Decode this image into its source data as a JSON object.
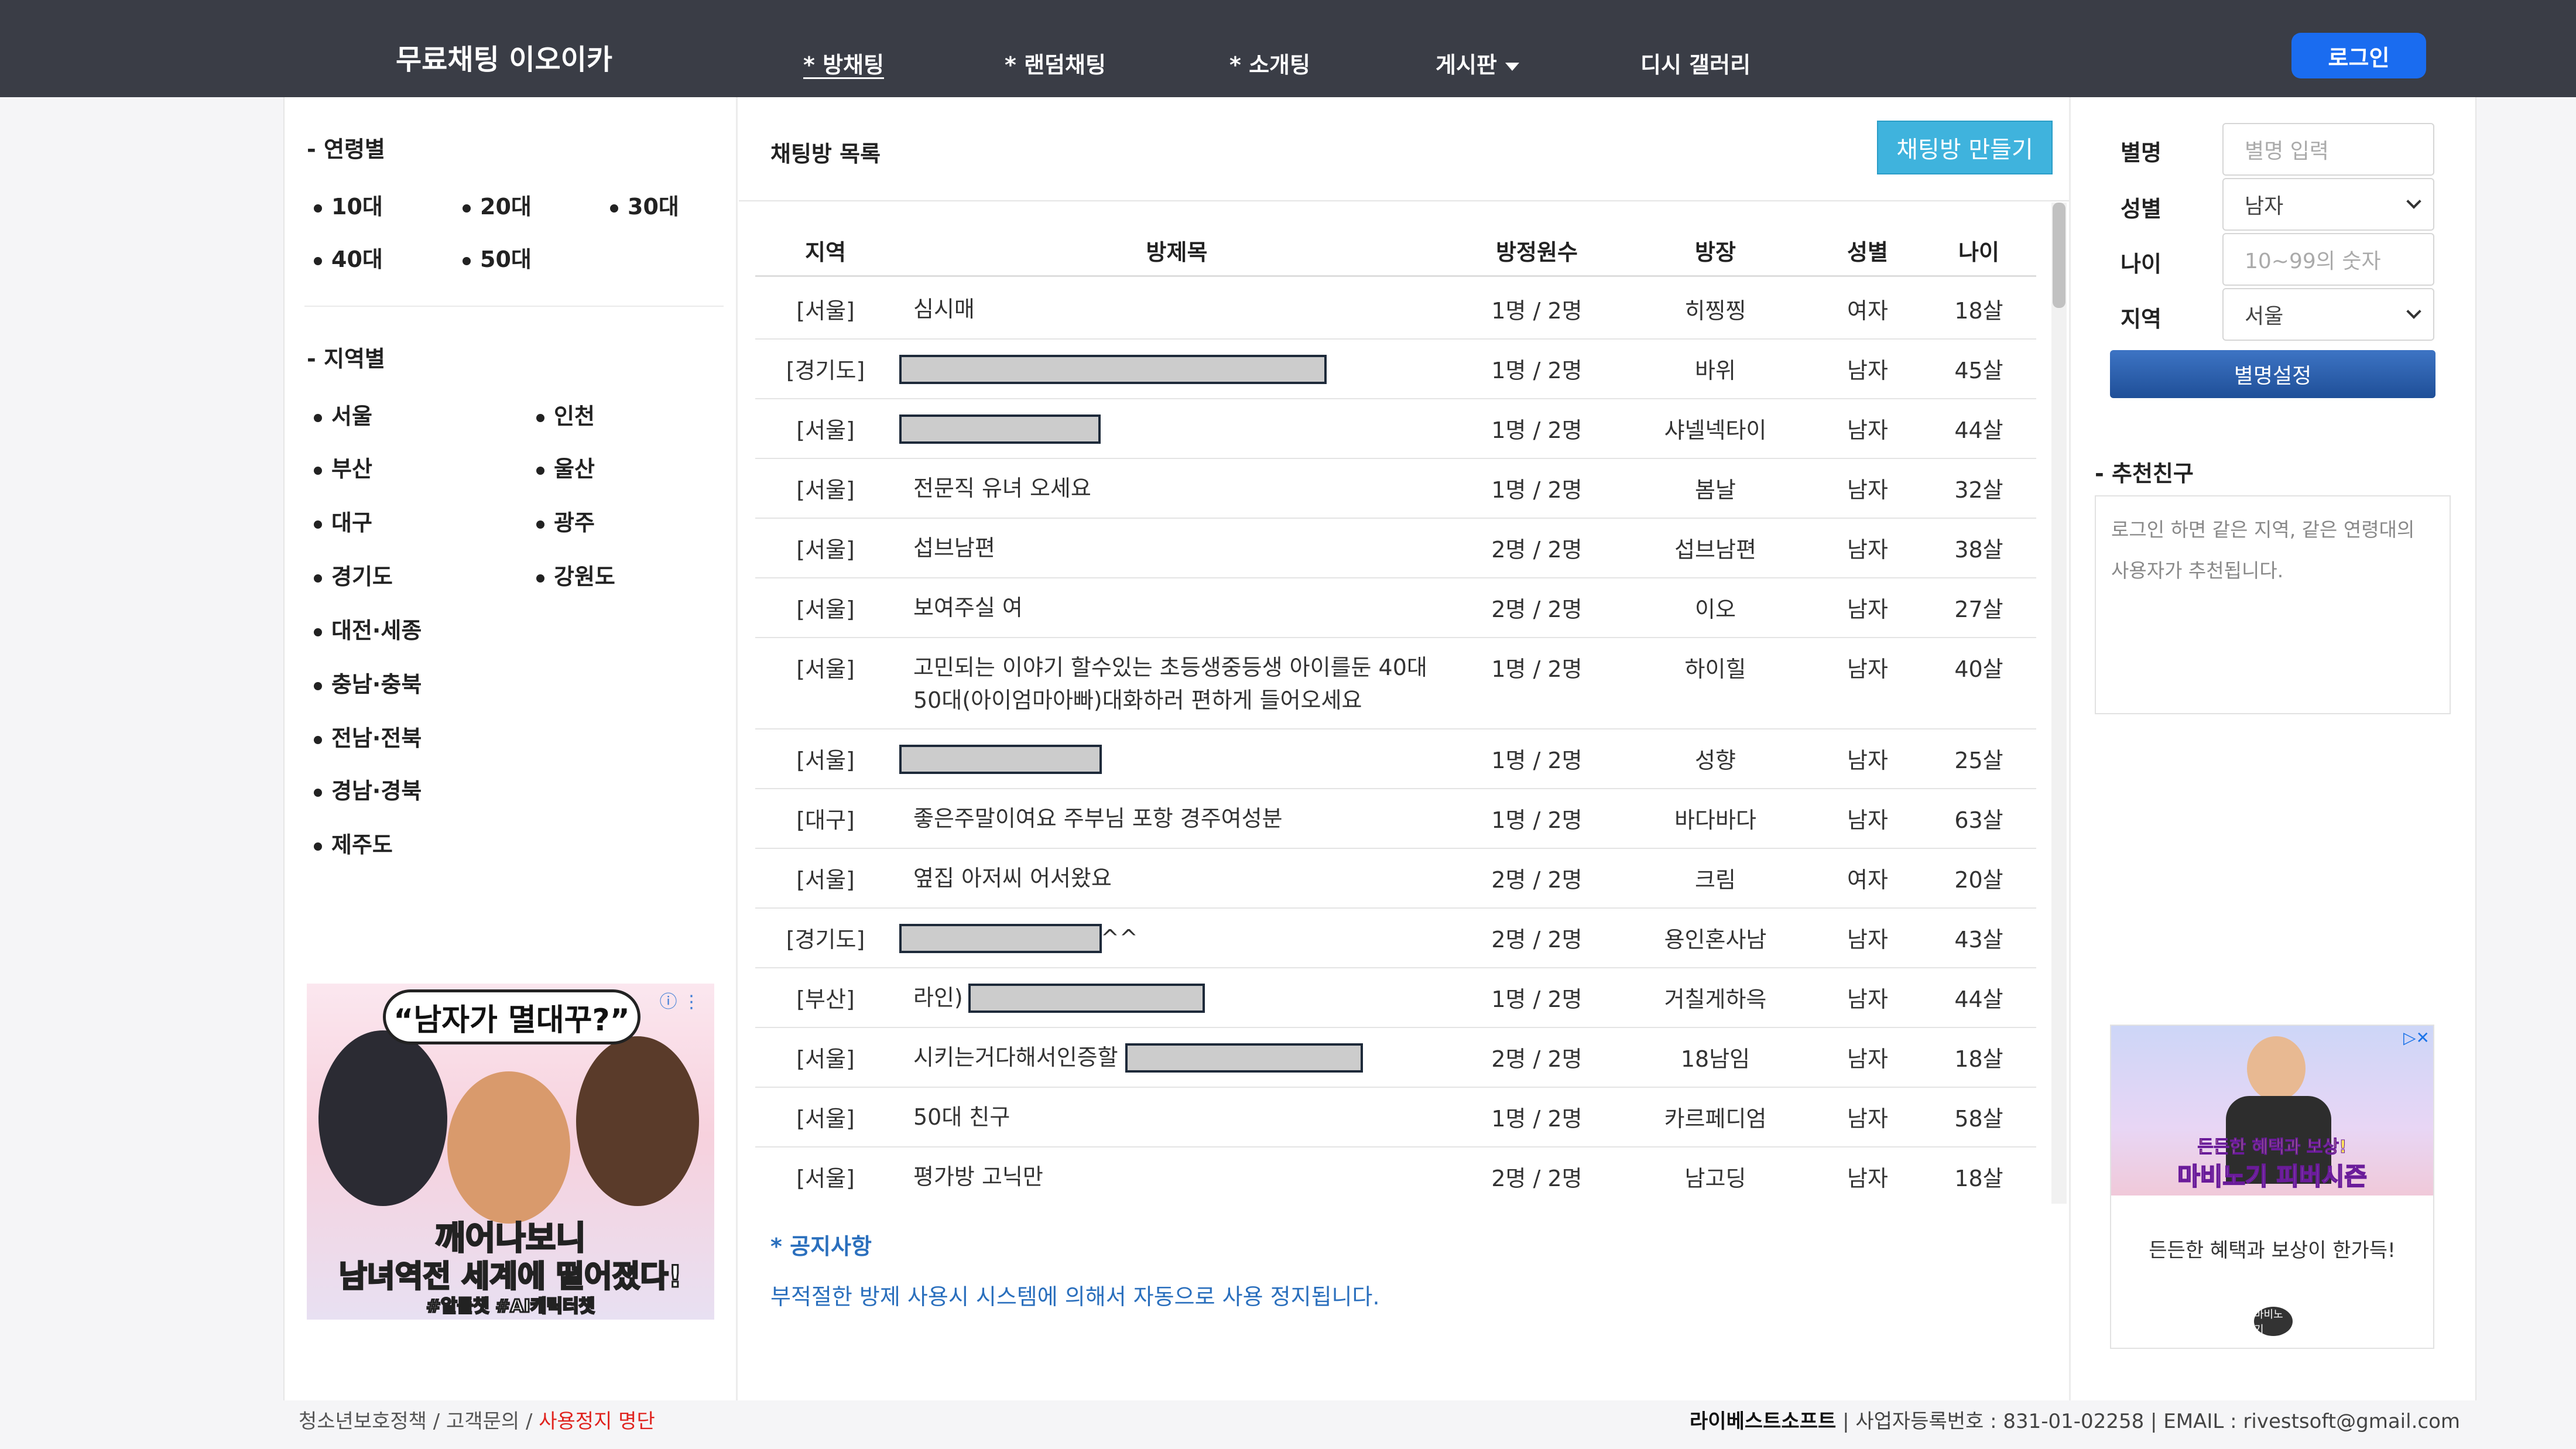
{
  "header": {
    "brand": "무료채팅 이오이카",
    "nav": [
      {
        "label": "* 방채팅",
        "active": true
      },
      {
        "label": "* 랜덤채팅",
        "active": false
      },
      {
        "label": "* 소개팅",
        "active": false
      },
      {
        "label": "게시판",
        "active": false
      },
      {
        "label": "디시 갤러리",
        "active": false
      }
    ],
    "login_label": "로그인"
  },
  "left": {
    "age_title": "- 연령별",
    "ages": [
      "10대",
      "20대",
      "30대",
      "40대",
      "50대"
    ],
    "region_title": "- 지역별",
    "regions": [
      "서울",
      "인천",
      "부산",
      "울산",
      "대구",
      "광주",
      "경기도",
      "강원도",
      "대전·세종",
      "충남·충북",
      "전남·전북",
      "경남·경북",
      "제주도"
    ],
    "ad": {
      "bubble": "“남자가 멸대꾸?”",
      "line1": "깨어나보니",
      "line2": "남녀역전 세계에 떨어졌다!",
      "tags": "#알툴챗 #AI캐릭터챗"
    }
  },
  "center": {
    "heading": "채팅방 목록",
    "make_button": "채팅방 만들기",
    "columns": [
      "지역",
      "방제목",
      "방정원수",
      "방장",
      "성별",
      "나이"
    ],
    "rows": [
      {
        "region": "[서울]",
        "title": "심시매",
        "redact": 0,
        "count": "1명 / 2명",
        "host": "히찡찡",
        "gender": "여자",
        "age": "18살"
      },
      {
        "region": "[경기도]",
        "title": "",
        "redact": 1,
        "count": "1명 / 2명",
        "host": "바위",
        "gender": "남자",
        "age": "45살"
      },
      {
        "region": "[서울]",
        "title": "",
        "redact": 1,
        "count": "1명 / 2명",
        "host": "샤넬넥타이",
        "gender": "남자",
        "age": "44살"
      },
      {
        "region": "[서울]",
        "title": "전문직 유녀 오세요",
        "redact": 0,
        "count": "1명 / 2명",
        "host": "봄날",
        "gender": "남자",
        "age": "32살"
      },
      {
        "region": "[서울]",
        "title": "섭브남편",
        "redact": 0,
        "count": "2명 / 2명",
        "host": "섭브남편",
        "gender": "남자",
        "age": "38살"
      },
      {
        "region": "[서울]",
        "title": "보여주실 여",
        "redact": 0,
        "count": "2명 / 2명",
        "host": "이오",
        "gender": "남자",
        "age": "27살"
      },
      {
        "region": "[서울]",
        "title": "고민되는 이야기 할수있는 초등생중등생 아이를둔 40대 50대(아이엄마아빠)대화하러 편하게 들어오세요",
        "redact": 0,
        "count": "1명 / 2명",
        "host": "하이힐",
        "gender": "남자",
        "age": "40살"
      },
      {
        "region": "[서울]",
        "title": "",
        "redact": 1,
        "count": "1명 / 2명",
        "host": "성향",
        "gender": "남자",
        "age": "25살"
      },
      {
        "region": "[대구]",
        "title": "좋은주말이여요 주부님 포항 경주여성분",
        "redact": 0,
        "count": "1명 / 2명",
        "host": "바다바다",
        "gender": "남자",
        "age": "63살"
      },
      {
        "region": "[서울]",
        "title": "옆집 아저씨 어서왔요",
        "redact": 0,
        "count": "2명 / 2명",
        "host": "크림",
        "gender": "여자",
        "age": "20살"
      },
      {
        "region": "[경기도]",
        "title": "^^",
        "redact": 2,
        "count": "2명 / 2명",
        "host": "용인혼사남",
        "gender": "남자",
        "age": "43살"
      },
      {
        "region": "[부산]",
        "title": "라인)",
        "redact": 3,
        "count": "1명 / 2명",
        "host": "거칠게하윽",
        "gender": "남자",
        "age": "44살"
      },
      {
        "region": "[서울]",
        "title": "시키는거다해서인증할",
        "redact": 4,
        "count": "2명 / 2명",
        "host": "18남임",
        "gender": "남자",
        "age": "18살"
      },
      {
        "region": "[서울]",
        "title": "50대 친구",
        "redact": 0,
        "count": "1명 / 2명",
        "host": "카르페디엄",
        "gender": "남자",
        "age": "58살"
      },
      {
        "region": "[서울]",
        "title": "평가방 고닉만",
        "redact": 0,
        "count": "2명 / 2명",
        "host": "남고딩",
        "gender": "남자",
        "age": "18살"
      }
    ],
    "notice_title": "* 공지사항",
    "notice_text": "부적절한 방제 사용시 시스템에 의해서 자동으로 사용 정지됩니다."
  },
  "right": {
    "labels": {
      "nick": "별명",
      "gender": "성별",
      "age": "나이",
      "region": "지역"
    },
    "nick_placeholder": "별명 입력",
    "gender_value": "남자",
    "age_placeholder": "10~99의 숫자",
    "region_value": "서울",
    "nick_button": "별명설정",
    "rec_title": "- 추천친구",
    "rec_text": "로그인 하면 같은 지역, 같은 연령대의 사용자가 추천됩니다.",
    "ad": {
      "sub": "든든한 혜택과 보상!",
      "banner": "마비노기 피버시즌",
      "text": "든든한 혜택과 보상이 한가득!",
      "logo": "마비노기"
    }
  },
  "footer": {
    "left_links": [
      "청소년보호정책",
      "고객문의"
    ],
    "left_red": "사용정지 명단",
    "company": "라이베스트소프트",
    "info": " | 사업자등록번호 : 831-01-02258 | EMAIL : rivestsoft@gmail.com"
  },
  "colors": {
    "header_bg": "#3a3d46",
    "login_btn": "#1a6cf0",
    "make_btn": "#3fb3dd",
    "notice": "#2a6fbd",
    "footer_red": "#e0231e"
  }
}
